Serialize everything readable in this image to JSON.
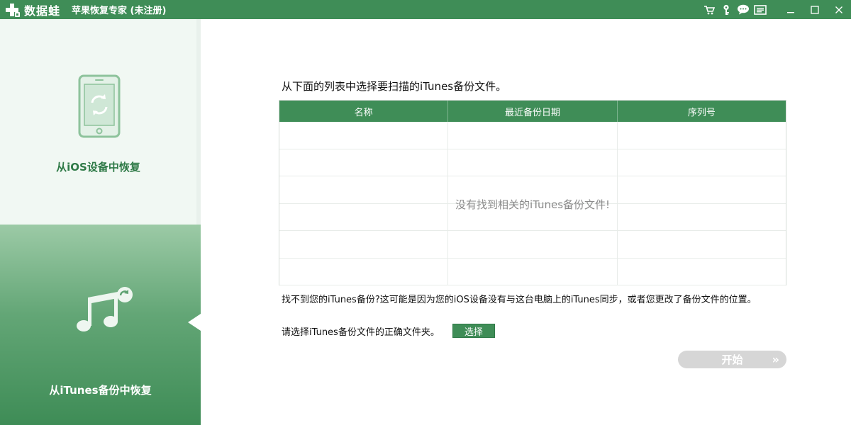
{
  "app": {
    "logo_text": "数据蛙",
    "title": "苹果恢复专家 (未注册)"
  },
  "colors": {
    "brand_green": "#3f8d57",
    "sidebar_light": "#f1f8f3",
    "disabled_button": "#d6d6d6"
  },
  "titlebar_icons": [
    "cart-icon",
    "key-icon",
    "chat-icon",
    "feedback-icon",
    "minimize-icon",
    "maximize-icon",
    "close-icon"
  ],
  "sidebar": {
    "ios_label": "从iOS设备中恢复",
    "itunes_label": "从iTunes备份中恢复",
    "active": "itunes"
  },
  "main": {
    "instruction": "从下面的列表中选择要扫描的iTunes备份文件。",
    "table": {
      "columns": [
        "名称",
        "最近备份日期",
        "序列号"
      ],
      "empty_message": "没有找到相关的iTunes备份文件!"
    },
    "help_text": "找不到您的iTunes备份?这可能是因为您的iOS设备没有与这台电脑上的iTunes同步，或者您更改了备份文件的位置。",
    "choose_label": "请选择iTunes备份文件的正确文件夹。",
    "select_button": "选择",
    "start_button": "开始",
    "start_arrows": "»"
  }
}
